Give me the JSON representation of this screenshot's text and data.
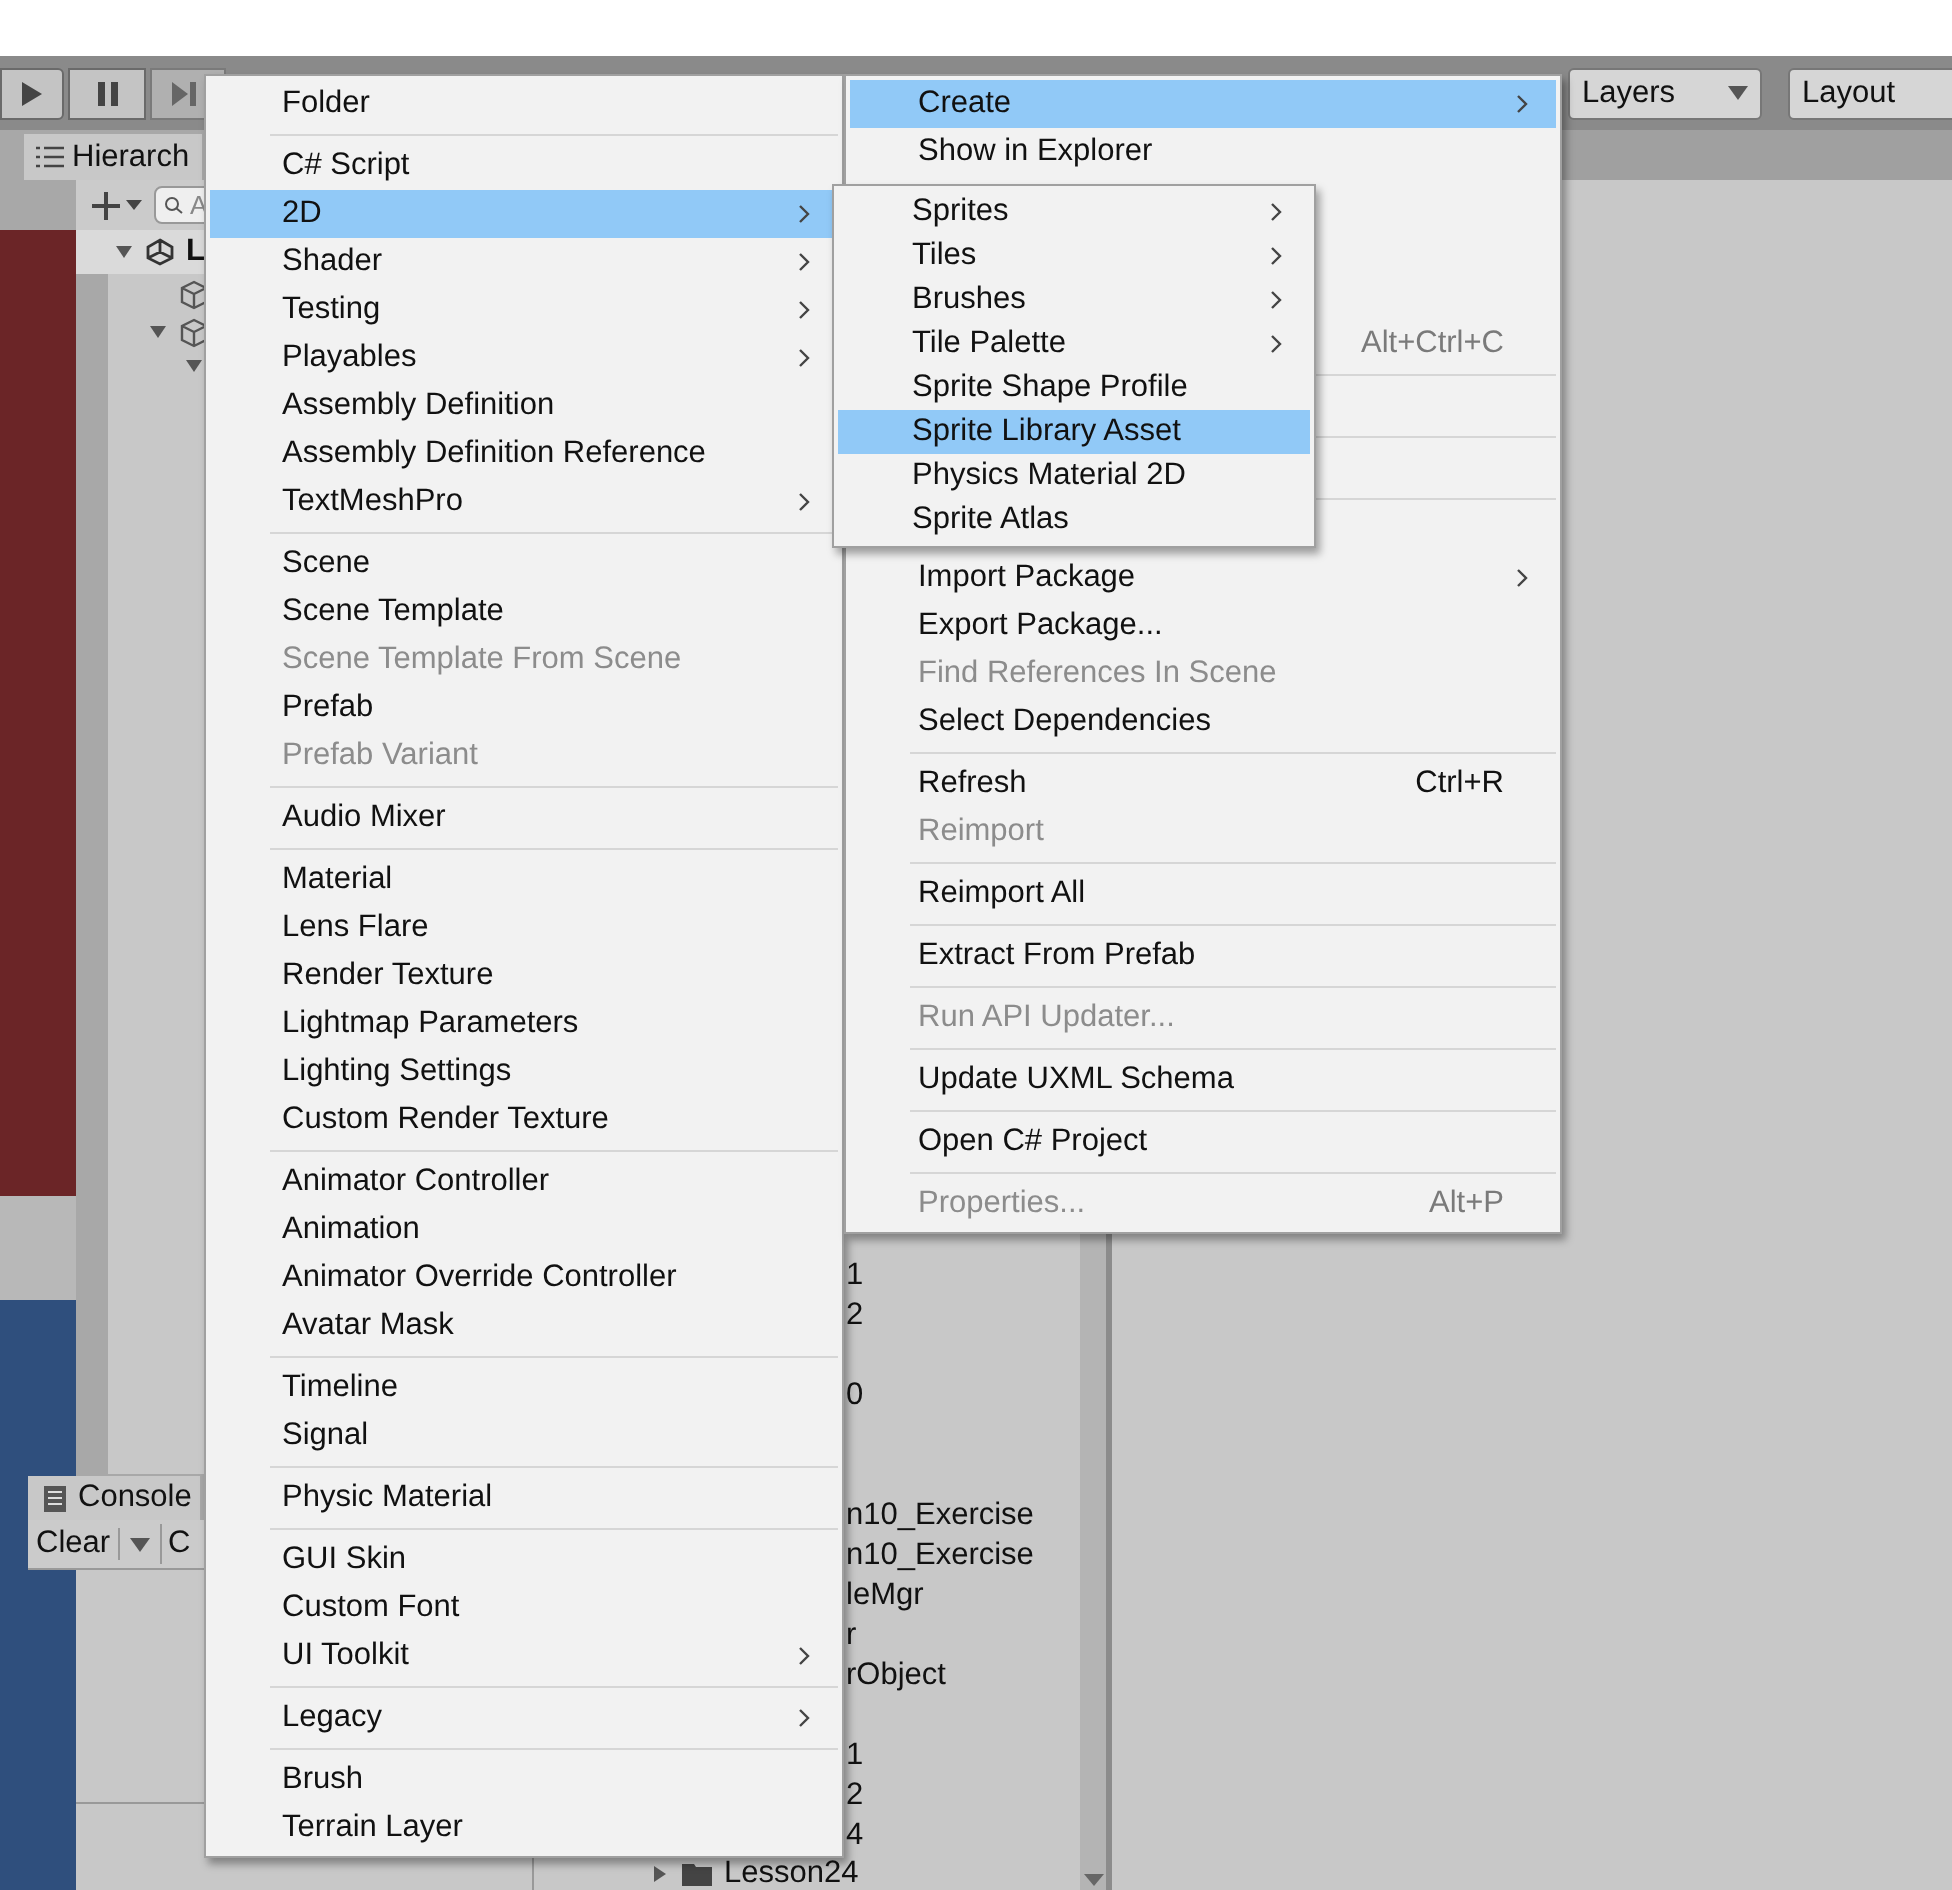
{
  "toolbar": {
    "layers": "Layers",
    "layout": "Layout"
  },
  "hierarchy": {
    "tab": "Hierarch",
    "search_placeholder": "A",
    "root": "L"
  },
  "console": {
    "tab": "Console",
    "clear": "Clear",
    "collapse": "C"
  },
  "project": {
    "rows": [
      {
        "kind": "text",
        "label": "1"
      },
      {
        "kind": "text",
        "label": "2"
      },
      {
        "kind": "covered"
      },
      {
        "kind": "text",
        "label": "0"
      },
      {
        "kind": "covered"
      },
      {
        "kind": "covered"
      },
      {
        "kind": "text",
        "label": "n10_Exercise"
      },
      {
        "kind": "text",
        "label": "n10_Exercise"
      },
      {
        "kind": "text",
        "label": "leMgr"
      },
      {
        "kind": "text",
        "label": "r"
      },
      {
        "kind": "text",
        "label": "rObject"
      },
      {
        "kind": "covered"
      },
      {
        "kind": "text",
        "label": "1"
      },
      {
        "kind": "text",
        "label": "2"
      },
      {
        "kind": "text",
        "label": "4"
      },
      {
        "kind": "folder",
        "label": "Lesson24"
      }
    ]
  },
  "menus": [
    {
      "kind": "create",
      "items": [
        {
          "kind": "item",
          "label": "Folder",
          "submenu": false,
          "disabled": false,
          "selected": false
        },
        {
          "kind": "separator"
        },
        {
          "kind": "item",
          "label": "C# Script",
          "submenu": false,
          "disabled": false,
          "selected": false
        },
        {
          "kind": "item",
          "label": "2D",
          "submenu": true,
          "disabled": false,
          "selected": true
        },
        {
          "kind": "item",
          "label": "Shader",
          "submenu": true,
          "disabled": false,
          "selected": false
        },
        {
          "kind": "item",
          "label": "Testing",
          "submenu": true,
          "disabled": false,
          "selected": false
        },
        {
          "kind": "item",
          "label": "Playables",
          "submenu": true,
          "disabled": false,
          "selected": false
        },
        {
          "kind": "item",
          "label": "Assembly Definition",
          "submenu": false,
          "disabled": false,
          "selected": false
        },
        {
          "kind": "item",
          "label": "Assembly Definition Reference",
          "submenu": false,
          "disabled": false,
          "selected": false
        },
        {
          "kind": "item",
          "label": "TextMeshPro",
          "submenu": true,
          "disabled": false,
          "selected": false
        },
        {
          "kind": "separator"
        },
        {
          "kind": "item",
          "label": "Scene",
          "submenu": false,
          "disabled": false,
          "selected": false
        },
        {
          "kind": "item",
          "label": "Scene Template",
          "submenu": false,
          "disabled": false,
          "selected": false
        },
        {
          "kind": "item",
          "label": "Scene Template From Scene",
          "submenu": false,
          "disabled": true,
          "selected": false
        },
        {
          "kind": "item",
          "label": "Prefab",
          "submenu": false,
          "disabled": false,
          "selected": false
        },
        {
          "kind": "item",
          "label": "Prefab Variant",
          "submenu": false,
          "disabled": true,
          "selected": false
        },
        {
          "kind": "separator"
        },
        {
          "kind": "item",
          "label": "Audio Mixer",
          "submenu": false,
          "disabled": false,
          "selected": false
        },
        {
          "kind": "separator"
        },
        {
          "kind": "item",
          "label": "Material",
          "submenu": false,
          "disabled": false,
          "selected": false
        },
        {
          "kind": "item",
          "label": "Lens Flare",
          "submenu": false,
          "disabled": false,
          "selected": false
        },
        {
          "kind": "item",
          "label": "Render Texture",
          "submenu": false,
          "disabled": false,
          "selected": false
        },
        {
          "kind": "item",
          "label": "Lightmap Parameters",
          "submenu": false,
          "disabled": false,
          "selected": false
        },
        {
          "kind": "item",
          "label": "Lighting Settings",
          "submenu": false,
          "disabled": false,
          "selected": false
        },
        {
          "kind": "item",
          "label": "Custom Render Texture",
          "submenu": false,
          "disabled": false,
          "selected": false
        },
        {
          "kind": "separator"
        },
        {
          "kind": "item",
          "label": "Animator Controller",
          "submenu": false,
          "disabled": false,
          "selected": false
        },
        {
          "kind": "item",
          "label": "Animation",
          "submenu": false,
          "disabled": false,
          "selected": false
        },
        {
          "kind": "item",
          "label": "Animator Override Controller",
          "submenu": false,
          "disabled": false,
          "selected": false
        },
        {
          "kind": "item",
          "label": "Avatar Mask",
          "submenu": false,
          "disabled": false,
          "selected": false
        },
        {
          "kind": "separator"
        },
        {
          "kind": "item",
          "label": "Timeline",
          "submenu": false,
          "disabled": false,
          "selected": false
        },
        {
          "kind": "item",
          "label": "Signal",
          "submenu": false,
          "disabled": false,
          "selected": false
        },
        {
          "kind": "separator"
        },
        {
          "kind": "item",
          "label": "Physic Material",
          "submenu": false,
          "disabled": false,
          "selected": false
        },
        {
          "kind": "separator"
        },
        {
          "kind": "item",
          "label": "GUI Skin",
          "submenu": false,
          "disabled": false,
          "selected": false
        },
        {
          "kind": "item",
          "label": "Custom Font",
          "submenu": false,
          "disabled": false,
          "selected": false
        },
        {
          "kind": "item",
          "label": "UI Toolkit",
          "submenu": true,
          "disabled": false,
          "selected": false
        },
        {
          "kind": "separator"
        },
        {
          "kind": "item",
          "label": "Legacy",
          "submenu": true,
          "disabled": false,
          "selected": false
        },
        {
          "kind": "separator"
        },
        {
          "kind": "item",
          "label": "Brush",
          "submenu": false,
          "disabled": false,
          "selected": false
        },
        {
          "kind": "item",
          "label": "Terrain Layer",
          "submenu": false,
          "disabled": false,
          "selected": false
        }
      ]
    },
    {
      "kind": "context",
      "items": [
        {
          "kind": "item",
          "label": "Create",
          "submenu": true,
          "disabled": false,
          "selected": true
        },
        {
          "kind": "item",
          "label": "Show in Explorer",
          "submenu": false,
          "disabled": false,
          "selected": false
        },
        {
          "kind": "blank"
        },
        {
          "kind": "blank"
        },
        {
          "kind": "blank"
        },
        {
          "kind": "item",
          "shortcut": "Alt+Ctrl+C",
          "submenu": false,
          "disabled": true,
          "selected": false
        },
        {
          "kind": "separator"
        },
        {
          "kind": "blank"
        },
        {
          "kind": "separator"
        },
        {
          "kind": "blank"
        },
        {
          "kind": "separator"
        },
        {
          "kind": "blank"
        },
        {
          "kind": "item",
          "label": "Import Package",
          "submenu": true,
          "disabled": false,
          "selected": false
        },
        {
          "kind": "item",
          "label": "Export Package...",
          "submenu": false,
          "disabled": false,
          "selected": false
        },
        {
          "kind": "item",
          "label": "Find References In Scene",
          "submenu": false,
          "disabled": true,
          "selected": false
        },
        {
          "kind": "item",
          "label": "Select Dependencies",
          "submenu": false,
          "disabled": false,
          "selected": false
        },
        {
          "kind": "separator"
        },
        {
          "kind": "item",
          "label": "Refresh",
          "shortcut": "Ctrl+R",
          "submenu": false,
          "disabled": false,
          "selected": false
        },
        {
          "kind": "item",
          "label": "Reimport",
          "submenu": false,
          "disabled": true,
          "selected": false
        },
        {
          "kind": "separator"
        },
        {
          "kind": "item",
          "label": "Reimport All",
          "submenu": false,
          "disabled": false,
          "selected": false
        },
        {
          "kind": "separator"
        },
        {
          "kind": "item",
          "label": "Extract From Prefab",
          "submenu": false,
          "disabled": false,
          "selected": false
        },
        {
          "kind": "separator"
        },
        {
          "kind": "item",
          "label": "Run API Updater...",
          "submenu": false,
          "disabled": true,
          "selected": false
        },
        {
          "kind": "separator"
        },
        {
          "kind": "item",
          "label": "Update UXML Schema",
          "submenu": false,
          "disabled": false,
          "selected": false
        },
        {
          "kind": "separator"
        },
        {
          "kind": "item",
          "label": "Open C# Project",
          "submenu": false,
          "disabled": false,
          "selected": false
        },
        {
          "kind": "separator"
        },
        {
          "kind": "item",
          "label": "Properties...",
          "shortcut": "Alt+P",
          "submenu": false,
          "disabled": true,
          "selected": false
        }
      ]
    },
    {
      "kind": "submenu",
      "items": [
        {
          "kind": "item",
          "label": "Sprites",
          "submenu": true,
          "disabled": false,
          "selected": false
        },
        {
          "kind": "item",
          "label": "Tiles",
          "submenu": true,
          "disabled": false,
          "selected": false
        },
        {
          "kind": "item",
          "label": "Brushes",
          "submenu": true,
          "disabled": false,
          "selected": false
        },
        {
          "kind": "item",
          "label": "Tile Palette",
          "submenu": true,
          "disabled": false,
          "selected": false
        },
        {
          "kind": "item",
          "label": "Sprite Shape Profile",
          "submenu": false,
          "disabled": false,
          "selected": false
        },
        {
          "kind": "item",
          "label": "Sprite Library Asset",
          "submenu": false,
          "disabled": false,
          "selected": true
        },
        {
          "kind": "item",
          "label": "Physics Material 2D",
          "submenu": false,
          "disabled": false,
          "selected": false
        },
        {
          "kind": "item",
          "label": "Sprite Atlas",
          "submenu": false,
          "disabled": false,
          "selected": false
        }
      ]
    }
  ]
}
